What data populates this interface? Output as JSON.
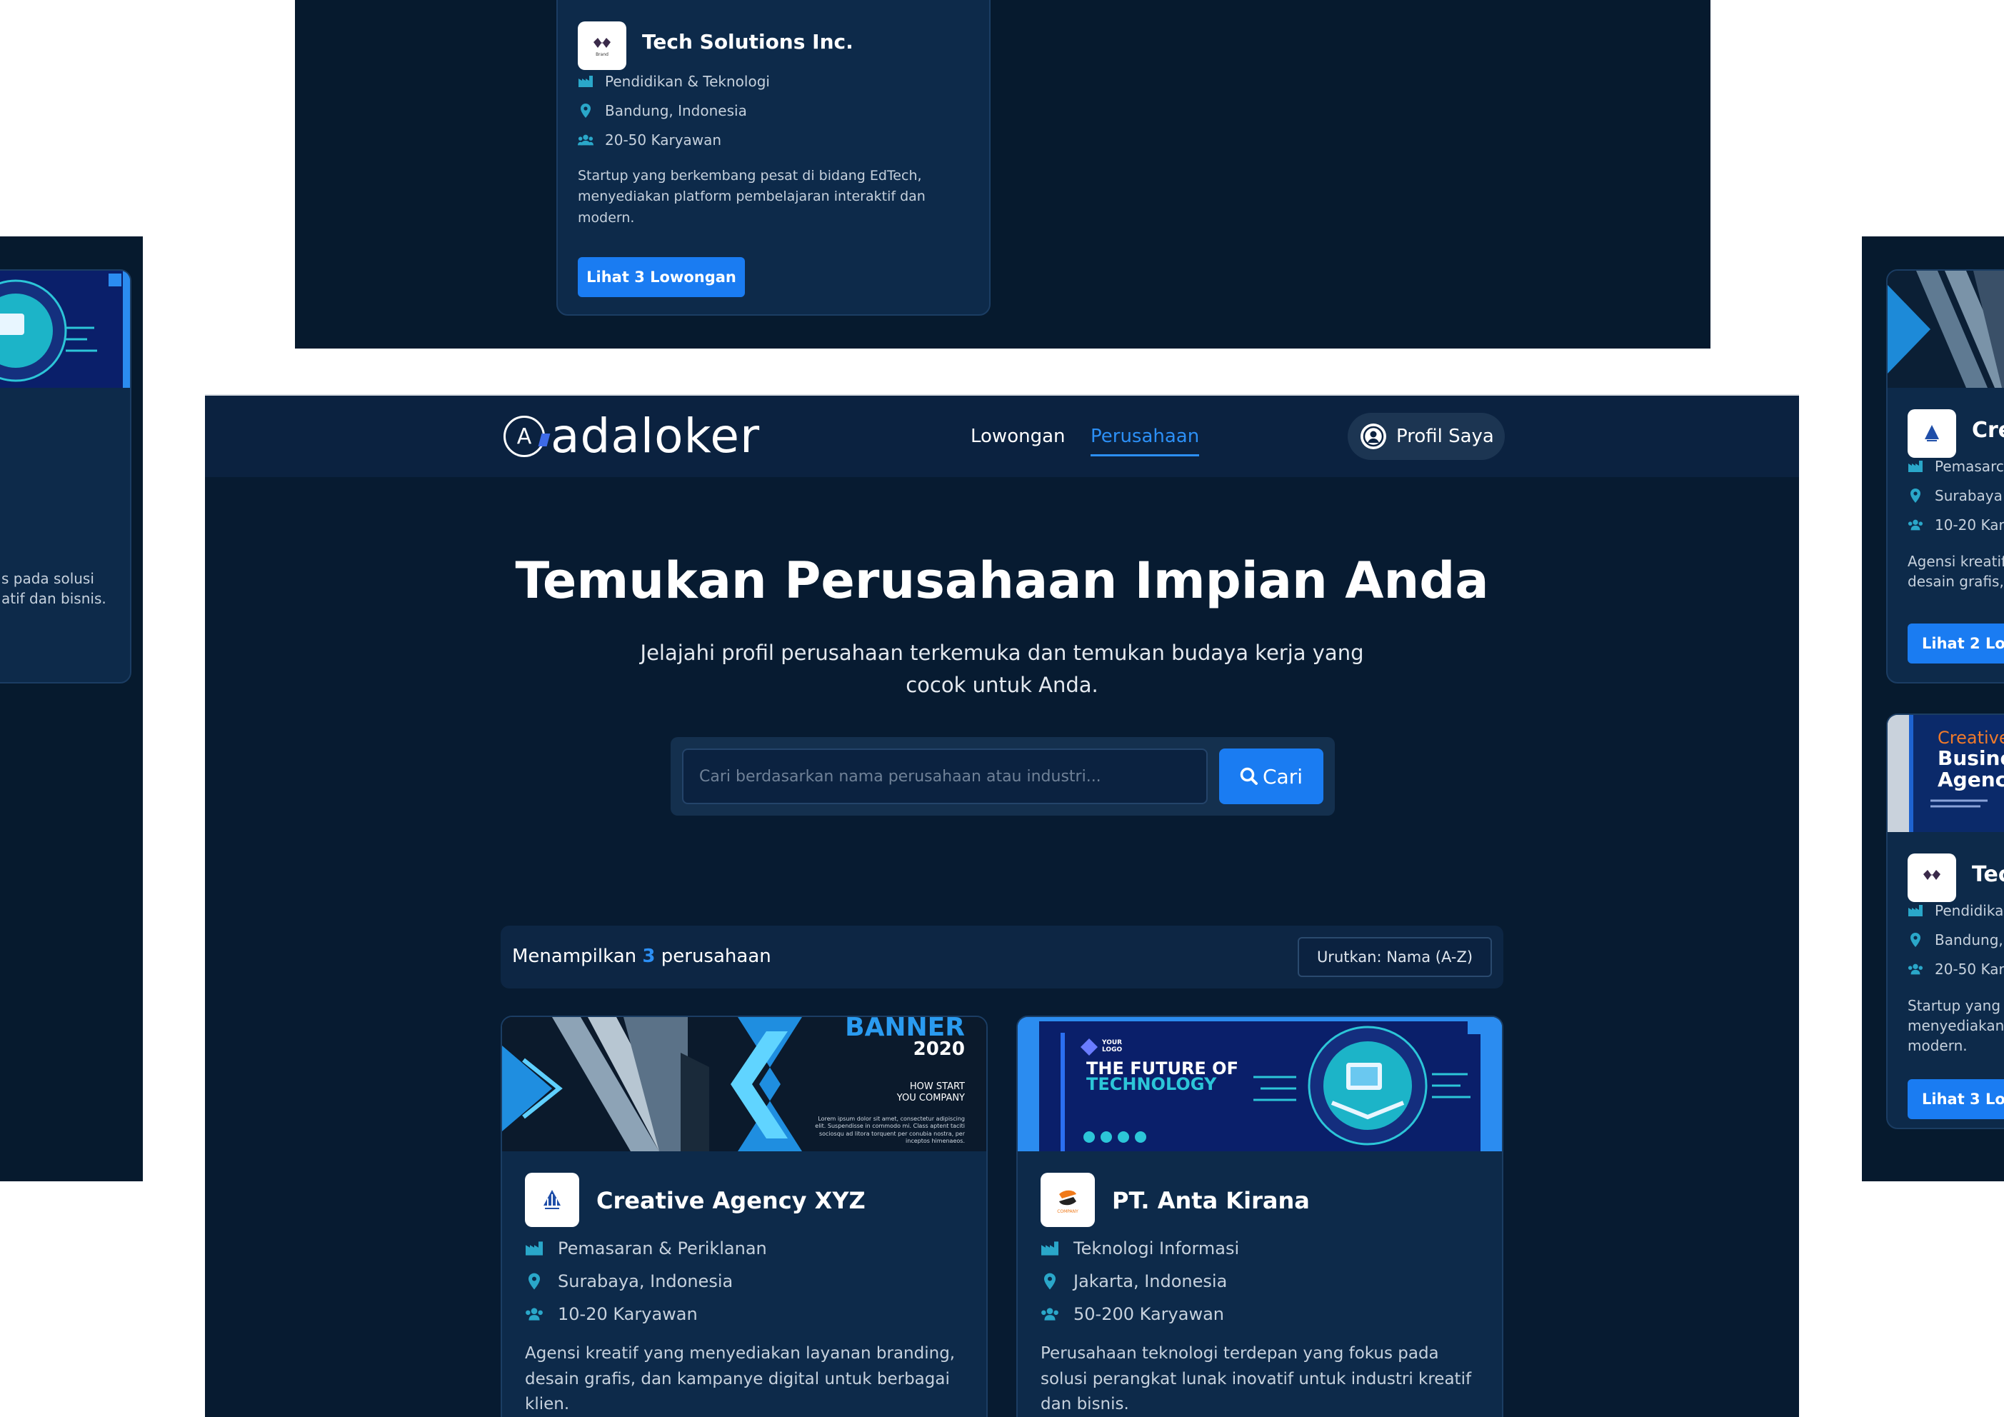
{
  "top_card": {
    "name": "Tech Solutions Inc.",
    "industry": "Pendidikan & Teknologi",
    "location": "Bandung, Indonesia",
    "size": "20-50 Karyawan",
    "description": "Startup yang berkembang pesat di bidang EdTech, menyediakan platform pembelajaran interaktif dan modern.",
    "button": "Lihat 3 Lowongan"
  },
  "left_fragment": {
    "desc_line1": "s pada solusi",
    "desc_line2": "atif dan bisnis."
  },
  "right_fragment": {
    "card1": {
      "name": "Cre",
      "industry": "Pemasarc",
      "location": "Surabaya",
      "size": "10-20 Kary",
      "desc_line1": "Agensi kreatif",
      "desc_line2": "desain grafis, c",
      "button": "Lihat 2 Low"
    },
    "card2": {
      "banner_line1": "Creative",
      "banner_line2": "Busine",
      "banner_line3": "Agenc",
      "name": "Tec",
      "industry": "Pendidika",
      "location": "Bandung,",
      "size": "20-50 Kar",
      "desc_line1": "Startup yang b",
      "desc_line2": "menyediakan",
      "desc_line3": "modern.",
      "button": "Lihat 3 Low"
    }
  },
  "nav": {
    "brand": "adaloker",
    "brand_mark": "A",
    "links": [
      "Lowongan",
      "Perusahaan"
    ],
    "active_index": 1,
    "profile": "Profil Saya"
  },
  "hero": {
    "title": "Temukan Perusahaan Impian Anda",
    "subtitle": "Jelajahi profil perusahaan terkemuka dan temukan budaya kerja yang cocok untuk Anda.",
    "search_placeholder": "Cari berdasarkan nama perusahaan atau industri...",
    "search_button": "Cari"
  },
  "results": {
    "prefix": "Menampilkan",
    "count": "3",
    "suffix": "perusahaan",
    "sort_label": "Urutkan: Nama (A-Z)"
  },
  "companies": [
    {
      "name": "Creative Agency XYZ",
      "industry": "Pemasaran & Periklanan",
      "location": "Surabaya, Indonesia",
      "size": "10-20 Karyawan",
      "description": "Agensi kreatif yang menyediakan layanan branding, desain grafis, dan kampanye digital untuk berbagai klien.",
      "banner": {
        "title": "BANNER",
        "year": "2020",
        "tag1": "HOW START",
        "tag2": "YOU COMPANY",
        "lorem": "Lorem ipsum dolor sit amet, consectetur adipiscing elit. Suspendisse in commodo mi. Class aptent taciti sociosqu ad litora torquent per conubia nostra, per inceptos himenaeos."
      }
    },
    {
      "name": "PT. Anta Kirana",
      "industry": "Teknologi Informasi",
      "location": "Jakarta, Indonesia",
      "size": "50-200 Karyawan",
      "description": "Perusahaan teknologi terdepan yang fokus pada solusi perangkat lunak inovatif untuk industri kreatif dan bisnis.",
      "banner": {
        "logo": "YOUR LOGO",
        "line1": "THE FUTURE OF",
        "line2": "TECHNOLOGY"
      }
    }
  ],
  "colors": {
    "page_bg": "#061a2e",
    "card_bg": "#0d2a4a",
    "accent": "#1a7cf2",
    "icon": "#2aa7c9",
    "text_muted": "#c6d1dd"
  },
  "icons": [
    "factory-icon",
    "map-pin-icon",
    "users-icon",
    "search-icon",
    "user-circle-icon"
  ]
}
